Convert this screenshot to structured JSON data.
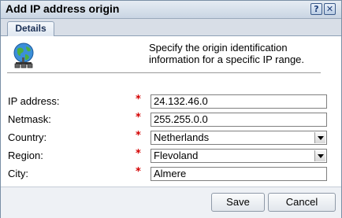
{
  "dialog": {
    "title": "Add IP address origin",
    "help_glyph": "?",
    "close_glyph": "✕",
    "tabs": [
      {
        "label": "Details"
      }
    ]
  },
  "intro": {
    "text": "Specify the origin identification information for a specific IP range.",
    "icon": "network-globe-icon"
  },
  "form": {
    "required_marker": "*",
    "fields": [
      {
        "label": "IP address:",
        "value": "24.132.46.0",
        "type": "text"
      },
      {
        "label": "Netmask:",
        "value": "255.255.0.0",
        "type": "text"
      },
      {
        "label": "Country:",
        "value": "Netherlands",
        "type": "select"
      },
      {
        "label": "Region:",
        "value": "Flevoland",
        "type": "select"
      },
      {
        "label": "City:",
        "value": "Almere",
        "type": "text"
      }
    ]
  },
  "buttons": {
    "save": "Save",
    "cancel": "Cancel"
  },
  "colors": {
    "required": "#d40000",
    "titlebar": "#c9d5e3"
  }
}
